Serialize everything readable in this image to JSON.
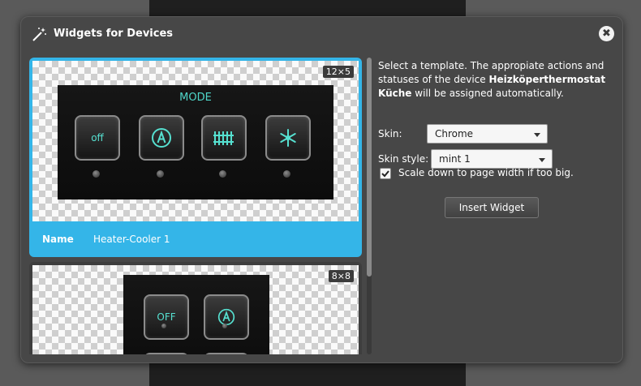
{
  "dialog": {
    "title": "Widgets for Devices",
    "close_glyph": "✖"
  },
  "templates": [
    {
      "size": "12×5",
      "name_label": "Name",
      "name_value": "Heater-Cooler 1",
      "preview": {
        "title": "MODE",
        "buttons": [
          "off",
          "auto-icon",
          "heater-icon",
          "snowflake-icon"
        ]
      }
    },
    {
      "size": "8×8",
      "preview": {
        "buttons": [
          "OFF",
          "auto-icon"
        ]
      }
    }
  ],
  "form": {
    "description_pre": "Select a template. The appropiate actions and statuses of the device ",
    "device_name": "Heizköperthermostat Küche",
    "description_post": " will be assigned automatically.",
    "skin_label": "Skin:",
    "skin_value": "Chrome",
    "skin_style_label": "Skin style:",
    "skin_style_value": "mint 1",
    "scale_label": "Scale down to page width if too big.",
    "scale_checked": true,
    "insert_label": "Insert Widget"
  },
  "colors": {
    "accent": "#34b5e8",
    "mint": "#56e0d0"
  }
}
